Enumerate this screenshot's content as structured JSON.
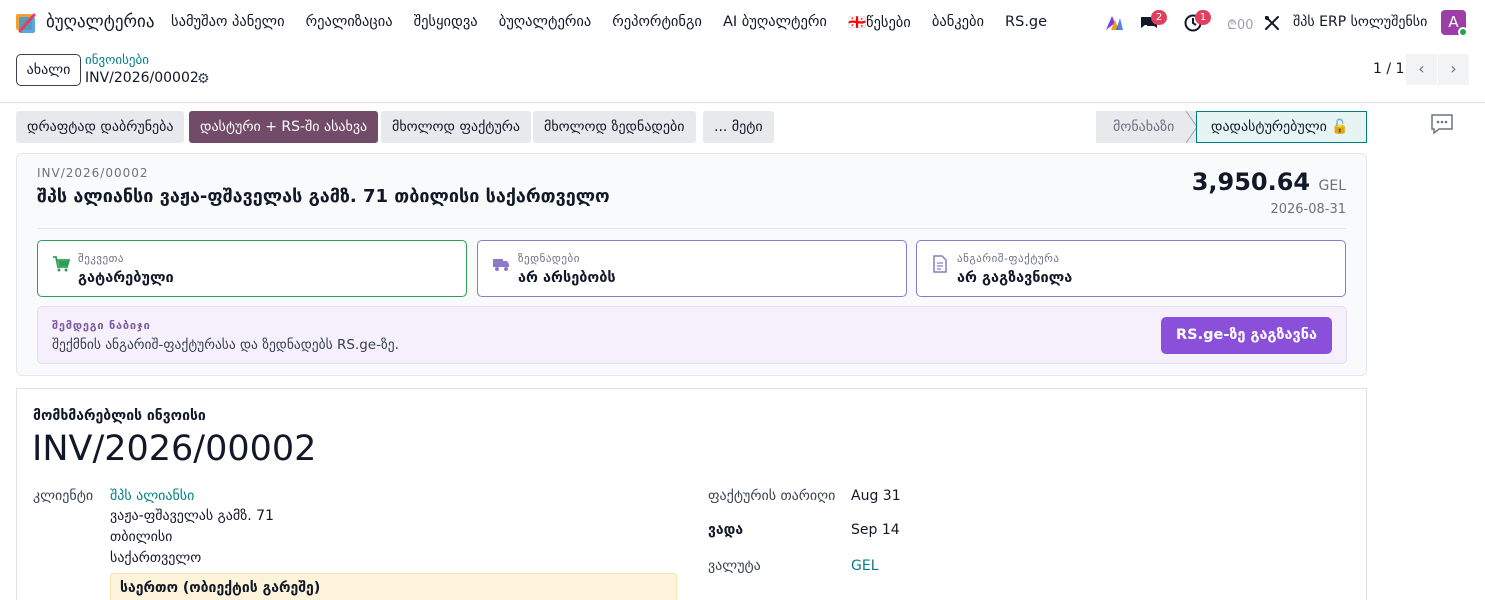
{
  "navbar": {
    "brand": "ბუღალტერია",
    "menu": [
      "სამუშაო პანელი",
      "რეალიზაცია",
      "შესყიდვა",
      "ბუღალტერია",
      "რეპორტინგი",
      "AI ბუღალტერი",
      "წესები",
      "ბანკები",
      "RS.ge"
    ],
    "rules_flag": "🇬🇪",
    "messages_count": "2",
    "activity_count": "1",
    "clock_text": "₾00",
    "company": "შპს ERP სოლუშენსი",
    "avatar_letter": "A"
  },
  "control_panel": {
    "new_button": "ახალი",
    "breadcrumb_parent": "ინვოისები",
    "breadcrumb_current": "INV/2026/00002",
    "pager": "1 / 1"
  },
  "actions": {
    "buttons": [
      "დრაფტად დაბრუნება",
      "დასტური + RS-ში ასახვა",
      "მხოლოდ ფაქტურა",
      "მხოლოდ ზედნადები",
      "... მეტი"
    ],
    "status_inactive": "მონახაზი",
    "status_active": "დადასტურებული 🔓"
  },
  "summary": {
    "number": "INV/2026/00002",
    "title": "შპს ალიანსი ვაჟა-ფშაველას გამზ. 71 თბილისი საქართველო",
    "amount": "3,950.64",
    "currency": "GEL",
    "date": "2026-08-31",
    "cards": [
      {
        "label": "შეკვეთა",
        "value": "გატარებული",
        "icon": "cart-icon",
        "color": "#2e9e57"
      },
      {
        "label": "ზედნადები",
        "value": "არ არსებობს",
        "icon": "truck-icon",
        "color": "#8b7bc8"
      },
      {
        "label": "ანგარიშ-ფაქტურა",
        "value": "არ გაგზავნილა",
        "icon": "document-icon",
        "color": "#8b7bc8"
      }
    ],
    "next_step_label": "შემდეგი ნაბიჯი",
    "next_step_text": "შექმნის ანგარიშ-ფაქტურასა და ზედნადებს RS.ge-ზე.",
    "next_step_button": "RS.ge-ზე გაგზავნა"
  },
  "form": {
    "subtitle": "მომხმარებლის ინვოისი",
    "title": "INV/2026/00002",
    "client_label": "კლიენტი",
    "client_name": "შპს ალიანსი",
    "client_address": [
      "ვაჟა-ფშაველას გამზ. 71",
      "თბილისი",
      "საქართველო"
    ],
    "invoice_date_label": "ფაქტურის თარიღი",
    "invoice_date": "Aug 31",
    "due_label": "ვადა",
    "due_date": "Sep 14",
    "currency_label": "ვალუტა",
    "currency": "GEL",
    "note": "საერთო (ობიექტის გარეშე)"
  },
  "colors": {
    "primary": "#714b67",
    "accent": "#8b50d9",
    "link": "#017e84"
  }
}
